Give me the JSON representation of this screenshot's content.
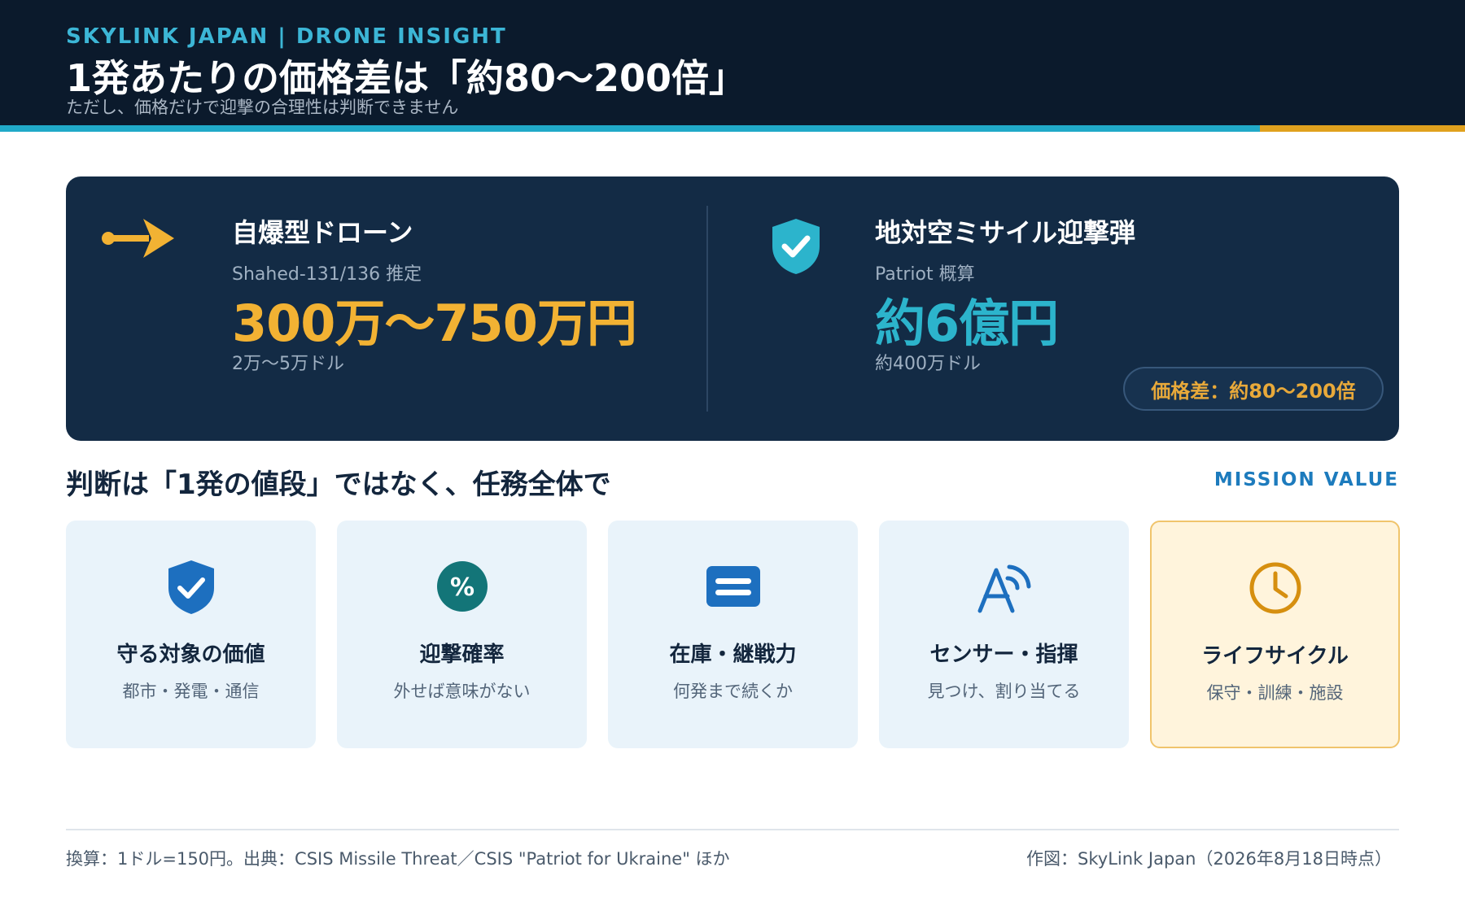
{
  "header": {
    "eyebrow": "SKYLINK JAPAN | DRONE INSIGHT",
    "title": "1発あたりの価格差は「約80〜200倍」",
    "subtitle": "ただし、価格だけで迎撃の合理性は判断できません"
  },
  "comparison": {
    "left": {
      "icon": "arrow-right-icon",
      "title": "自爆型ドローン",
      "subtitle": "Shahed-131/136 推定",
      "price": "300万〜750万円",
      "usd": "2万〜5万ドル"
    },
    "right": {
      "icon": "shield-check-icon",
      "title": "地対空ミサイル迎撃弾",
      "subtitle": "Patriot 概算",
      "price": "約6億円",
      "usd": "約400万ドル"
    },
    "badge": "価格差：約80〜200倍"
  },
  "section": {
    "title": "判断は「1発の値段」ではなく、任務全体で",
    "tag": "MISSION VALUE"
  },
  "cards": [
    {
      "icon": "shield-check-icon",
      "label": "守る対象の価値",
      "note": "都市・発電・通信"
    },
    {
      "icon": "percent-icon",
      "label": "迎撃確率",
      "note": "外せば意味がない"
    },
    {
      "icon": "stock-icon",
      "label": "在庫・継戦力",
      "note": "何発まで続くか"
    },
    {
      "icon": "sensor-icon",
      "label": "センサー・指揮",
      "note": "見つけ、割り当てる"
    },
    {
      "icon": "clock-icon",
      "label": "ライフサイクル",
      "note": "保守・訓練・施設"
    }
  ],
  "footer": {
    "source": "換算：1ドル=150円。出典：CSIS Missile Threat／CSIS \"Patriot for Ukraine\" ほか",
    "credit": "作図：SkyLink Japan（2026年8月18日時点）"
  },
  "colors": {
    "navy": "#0b1a2c",
    "panel": "#132b45",
    "accent_blue": "#20a9c8",
    "accent_orange": "#e0a11e",
    "drone_price": "#f2b233",
    "missile_price": "#2cb4cc"
  }
}
